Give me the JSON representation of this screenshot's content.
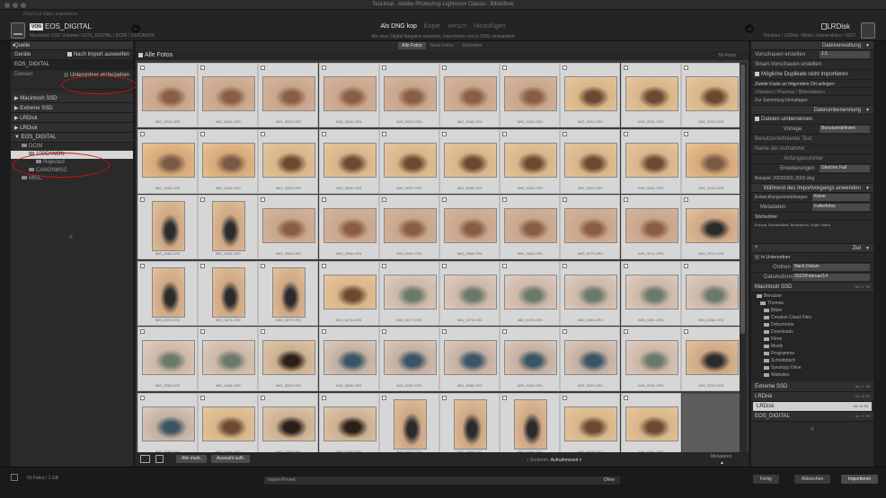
{
  "window": {
    "title": "Test.lrcat - Adobe Photoshop Lightroom Classic - Bibliothek",
    "subtitle": "Final Cut Video importieren"
  },
  "header": {
    "source_badge": "VON",
    "source_name": "EOS_DIGITAL",
    "source_path": "Macintosh SSD Volumes / EOS_DIGITAL / DCIM / 100CANON",
    "modes": [
      "Als DNG kop",
      "Kopie",
      "Versch",
      "Hinzufügen"
    ],
    "mode_active_index": 0,
    "mode_description": "Als neue Digital-Negative kopieren, importieren und in DNG umwandeln",
    "dest_name": "LRDisk",
    "dest_path": "Volumes / LRDisk / Birds / Kamerafotos / 2022"
  },
  "left": {
    "title": "Quelle",
    "device_label": "Geräte",
    "after_import_label": "Nach Import auswerfen",
    "device_name": "EOS_DIGITAL",
    "files_label": "Dateien",
    "subfolders_label": "Unterordner einbeziehen",
    "volumes": [
      "Macintosh SSD",
      "Extreme SSD",
      "LRDisk",
      "LRDisk",
      "EOS_DIGITAL"
    ],
    "folders": [
      {
        "name": "DCIM",
        "indent": 1
      },
      {
        "name": "100CANON",
        "indent": 2,
        "selected": true
      },
      {
        "name": "Rejected",
        "indent": 3
      },
      {
        "name": "CANONMSC",
        "indent": 2
      },
      {
        "name": "MISC",
        "indent": 1
      }
    ],
    "ornament": "❦"
  },
  "center": {
    "tabs": [
      "Alle Fotos",
      "Neue Fotos",
      "Zielordner"
    ],
    "tab_active": 0,
    "grid_title": "Alle Fotos",
    "count": "59 Fotos",
    "photos": [
      {
        "n": "IMG_9243.CR3",
        "t": "h",
        "k": "branch"
      },
      {
        "n": "IMG_9244.CR3",
        "t": "h",
        "k": "branch"
      },
      {
        "n": "IMG_9245.CR3",
        "t": "h",
        "k": "branch"
      },
      {
        "n": "IMG_9246.CR3",
        "t": "h",
        "k": "branch"
      },
      {
        "n": "IMG_9247.CR3",
        "t": "h",
        "k": "branch"
      },
      {
        "n": "IMG_9248.CR3",
        "t": "h",
        "k": "branch"
      },
      {
        "n": "IMG_9249.CR3",
        "t": "h",
        "k": "branch"
      },
      {
        "n": "IMG_9250.CR3",
        "t": "h",
        "k": "bird"
      },
      {
        "n": "IMG_9251.CR3",
        "t": "h",
        "k": "bird"
      },
      {
        "n": "IMG_9252.CR3",
        "t": "h",
        "k": "bird"
      },
      {
        "n": "IMG_9253.CR3",
        "t": "h",
        "k": "jay"
      },
      {
        "n": "IMG_9254.CR3",
        "t": "h",
        "k": "jay"
      },
      {
        "n": "IMG_9255.CR3",
        "t": "h",
        "k": "bird"
      },
      {
        "n": "IMG_9256.CR3",
        "t": "h",
        "k": "bird"
      },
      {
        "n": "IMG_9257.CR3",
        "t": "h",
        "k": "bird"
      },
      {
        "n": "IMG_9258.CR3",
        "t": "h",
        "k": "bird"
      },
      {
        "n": "IMG_9259.CR3",
        "t": "h",
        "k": "bird"
      },
      {
        "n": "IMG_9260.CR3",
        "t": "h",
        "k": "bird"
      },
      {
        "n": "IMG_9261.CR3",
        "t": "h",
        "k": "bird"
      },
      {
        "n": "IMG_9262.CR3",
        "t": "h",
        "k": "jay"
      },
      {
        "n": "IMG_9263.CR3",
        "t": "v",
        "k": "wood"
      },
      {
        "n": "IMG_9264.CR3",
        "t": "v",
        "k": "wood"
      },
      {
        "n": "IMG_9265.CR3",
        "t": "h",
        "k": "branch"
      },
      {
        "n": "IMG_9266.CR3",
        "t": "h",
        "k": "branch"
      },
      {
        "n": "IMG_9267.CR3",
        "t": "h",
        "k": "branch"
      },
      {
        "n": "IMG_9268.CR3",
        "t": "h",
        "k": "branch"
      },
      {
        "n": "IMG_9269.CR3",
        "t": "h",
        "k": "branch"
      },
      {
        "n": "IMG_9270.CR3",
        "t": "h",
        "k": "branch"
      },
      {
        "n": "IMG_9271.CR3",
        "t": "h",
        "k": "branch"
      },
      {
        "n": "IMG_9272.CR3",
        "t": "h",
        "k": "wood"
      },
      {
        "n": "IMG_9273.CR3",
        "t": "v",
        "k": "wood"
      },
      {
        "n": "IMG_9274.CR3",
        "t": "v",
        "k": "wood"
      },
      {
        "n": "IMG_9275.CR3",
        "t": "v",
        "k": "wood"
      },
      {
        "n": "IMG_9276.CR3",
        "t": "h",
        "k": "bird"
      },
      {
        "n": "IMG_9277.CR3",
        "t": "h",
        "k": "blur"
      },
      {
        "n": "IMG_9278.CR3",
        "t": "h",
        "k": "blur"
      },
      {
        "n": "IMG_9279.CR3",
        "t": "h",
        "k": "blur"
      },
      {
        "n": "IMG_9280.CR3",
        "t": "h",
        "k": "blur"
      },
      {
        "n": "IMG_9281.CR3",
        "t": "h",
        "k": "blur"
      },
      {
        "n": "IMG_9282.CR3",
        "t": "h",
        "k": "blur"
      },
      {
        "n": "IMG_9283.CR3",
        "t": "h",
        "k": "blur"
      },
      {
        "n": "IMG_9284.CR3",
        "t": "h",
        "k": "blur"
      },
      {
        "n": "IMG_9285.CR3",
        "t": "h",
        "k": "dark"
      },
      {
        "n": "IMG_9286.CR3",
        "t": "h",
        "k": "tit"
      },
      {
        "n": "IMG_9287.CR3",
        "t": "h",
        "k": "tit"
      },
      {
        "n": "IMG_9288.CR3",
        "t": "h",
        "k": "tit"
      },
      {
        "n": "IMG_9289.CR3",
        "t": "h",
        "k": "tit"
      },
      {
        "n": "IMG_9290.CR3",
        "t": "h",
        "k": "tit"
      },
      {
        "n": "IMG_9291.CR3",
        "t": "h",
        "k": "blur"
      },
      {
        "n": "IMG_9292.CR3",
        "t": "h",
        "k": "wood"
      },
      {
        "n": "IMG_9293.CR3",
        "t": "h",
        "k": "tit"
      },
      {
        "n": "IMG_9294.CR3",
        "t": "h",
        "k": "bird"
      },
      {
        "n": "IMG_9295.CR3",
        "t": "h",
        "k": "dark"
      },
      {
        "n": "IMG_9296.CR3",
        "t": "h",
        "k": "dark"
      },
      {
        "n": "IMG_9297.CR3",
        "t": "v",
        "k": "wood"
      },
      {
        "n": "IMG_9298.CR3",
        "t": "v",
        "k": "wood"
      },
      {
        "n": "IMG_9299.CR3",
        "t": "v",
        "k": "wood"
      },
      {
        "n": "IMG_9300.CR3",
        "t": "h",
        "k": "bird"
      },
      {
        "n": "IMG_9301.CR3",
        "t": "h",
        "k": "bird"
      }
    ],
    "toolbar": {
      "check_all": "Alle mark.",
      "uncheck_all": "Auswahl aufh.",
      "sort_label": "Sortieren:",
      "sort_value": "Aufnahmezeit",
      "thumbs_label": "Miniaturen"
    }
  },
  "right": {
    "file_handling": "Dateiverwaltung",
    "previews_label": "Vorschauen erstellen",
    "previews_value": "1:1",
    "smart_previews": "Smart-Vorschauen erstellen",
    "no_duplicates": "Mögliche Duplikate nicht importieren",
    "second_copy": "Zweite Kopie an folgendem Ort anlegen:",
    "second_copy_path": "/Volumes / Pharmaz / Bilderdateien",
    "add_collection": "Zur Sammlung hinzufügen",
    "rename_title": "Dateiumbenennung",
    "rename_check": "Dateien umbenennen",
    "template_label": "Vorlage",
    "template_value": "Benutzerdefiniert",
    "custom_text": "Benutzerdefinierter Text",
    "shoot_name": "Name der Aufnahme",
    "start_number": "Anfangsnummer",
    "extensions_label": "Erweiterungen",
    "extensions_value": "Gleicher Fall",
    "example": "Beispiel: 20220303_0002.dng",
    "apply_title": "Während des Importvorgangs anwenden",
    "develop_label": "Entwicklungseinstellungen",
    "develop_value": "Keine",
    "metadata_label": "Metadaten",
    "metadata_value": "Falterfotos",
    "keywords_label": "Stichwörter",
    "keywords": "Europa, Deutschland, Buntspecht, Vögel, Natur",
    "dest_title": "Ziel",
    "into_subfolder": "In Unterordner",
    "organize_label": "Ordnen",
    "organize_value": "Nach Datum",
    "date_format_label": "Datumsformat",
    "date_format_value": "2022/Februar/14",
    "vol_mac": "Macintosh SSD",
    "vol_mac_size": "64 / 1 TB",
    "dest_folders": [
      "Benutzer",
      "Thomas",
      "Bilder",
      "Creative Cloud Files",
      "Dokumente",
      "Downloads",
      "Filme",
      "Musik",
      "Programme",
      "Schreibtisch",
      "Synology Drive",
      "Websites"
    ],
    "vol_ext": "Extreme SSD",
    "vol_ext_size": "64 / 1 TB",
    "vol_lr1": "LRDisk",
    "vol_lr1_size": "64 / 8 TB",
    "vol_lr2": "LRDisk",
    "vol_lr2_size": "64 / 8 TB",
    "vol_eos": "EOS_DIGITAL",
    "vol_eos_size": "64 / 1 TB",
    "ornament": "❦"
  },
  "bottom": {
    "status": "59 Fotos / 1 GB",
    "preset_label": "Import-Preset:",
    "preset_value": "Ohne",
    "btn_done": "Fertig",
    "btn_cancel": "Abbrechen",
    "btn_import": "Importieren"
  }
}
